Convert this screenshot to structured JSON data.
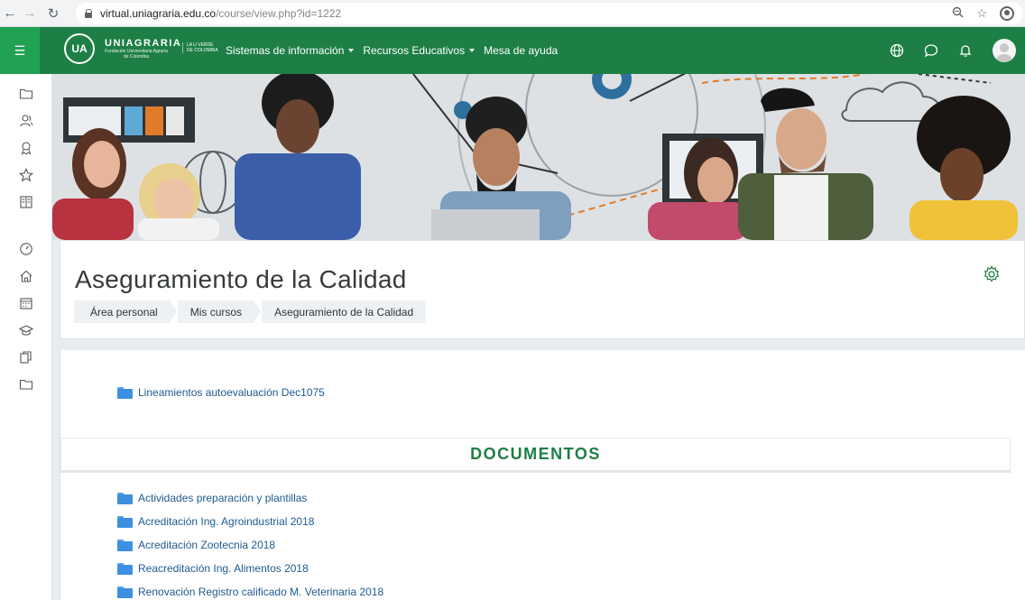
{
  "browser": {
    "url_domain": "virtual.uniagraria.edu.co",
    "url_path": "/course/view.php?id=1222"
  },
  "navbar": {
    "logo_initials": "UA",
    "logo_name": "UNIAGRARIA",
    "logo_sub": "Fundación Universitaria Agraria de Colombia",
    "logo_tagline": "LA U VERDE DE COLOMBIA",
    "menu": [
      {
        "label": "Sistemas de información",
        "has_dropdown": true
      },
      {
        "label": "Recursos Educativos",
        "has_dropdown": true
      },
      {
        "label": "Mesa de ayuda",
        "has_dropdown": false
      }
    ]
  },
  "drawer_icons": [
    "folder-icon",
    "users-icon",
    "badge-icon",
    "star-icon",
    "book-icon",
    "dashboard-icon",
    "home-icon",
    "calendar-icon",
    "graduation-cap-icon",
    "files-icon",
    "folder-icon"
  ],
  "course": {
    "title": "Aseguramiento de la Calidad",
    "breadcrumb": [
      "Área personal",
      "Mis cursos",
      "Aseguramiento de la Calidad"
    ]
  },
  "top_folder": "Lineamientos autoevaluación Dec1075",
  "section": {
    "title": "DOCUMENTOS",
    "folders": [
      "Actividades preparación y plantillas",
      "Acreditación Ing. Agroindustrial 2018",
      "Acreditación Zootecnia 2018",
      "Reacreditación Ing. Alimentos 2018",
      "Renovación Registro calificado M. Veterinaria 2018"
    ]
  },
  "colors": {
    "brand_green": "#1d7f45",
    "hamburger_green": "#21a253",
    "folder_blue": "#3d8fe0",
    "link_blue": "#1f5a8e"
  }
}
